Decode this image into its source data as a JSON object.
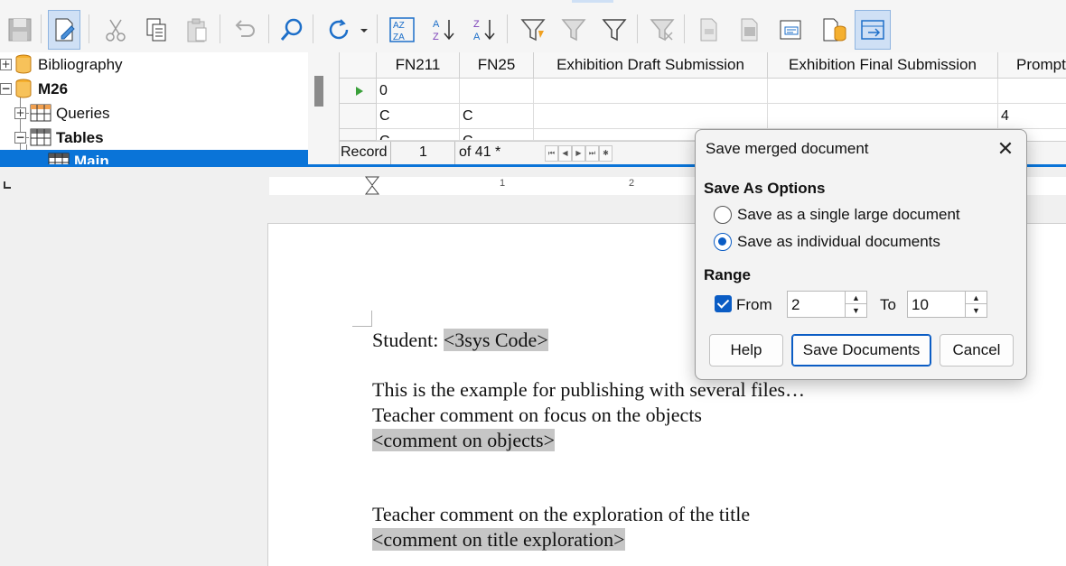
{
  "toolbar": {
    "icons": [
      "save-record-icon",
      "edit-data-icon",
      "cut-icon",
      "copy-icon",
      "paste-icon",
      "undo-icon",
      "find-record-icon",
      "refresh-icon",
      "sort-icon",
      "sort-ascending-icon",
      "sort-descending-icon",
      "autofilter-icon",
      "standard-filter-icon",
      "apply-filter-icon",
      "reset-filter-icon",
      "data-to-text-icon",
      "data-to-fields-icon",
      "mail-merge-icon",
      "data-source-icon",
      "explorer-toggle-icon"
    ]
  },
  "tree": {
    "items": [
      {
        "label": "Bibliography"
      },
      {
        "label": "M26"
      },
      {
        "label": "Queries"
      },
      {
        "label": "Tables"
      },
      {
        "label": "Main"
      }
    ]
  },
  "grid": {
    "columns": [
      "FN211",
      "FN25",
      "Exhibition Draft Submission",
      "Exhibition Final Submission",
      "Prompt"
    ],
    "rows": [
      [
        "0",
        "",
        "",
        "",
        ""
      ],
      [
        "C",
        "C",
        "",
        "",
        "4"
      ],
      [
        "C",
        "C",
        "",
        "",
        ""
      ]
    ],
    "nav": {
      "record_label": "Record",
      "record_value": "1",
      "of_label": "of 41 *"
    }
  },
  "ruler": {
    "numbers": [
      "1",
      "2"
    ]
  },
  "document": {
    "line1_label": "Student: ",
    "line1_field": "<3sys Code>",
    "line2": "This is the example for publishing with several files…",
    "line3": "Teacher comment on focus on the objects",
    "line4_field": "<comment on objects>",
    "line5": "Teacher comment on the exploration of the title",
    "line6_field": "<comment on title exploration>"
  },
  "dialog": {
    "title": "Save merged document",
    "save_as_heading": "Save As Options",
    "option_single": "Save as a single large document",
    "option_individual": "Save as individual documents",
    "selected_option": "individual",
    "range_heading": "Range",
    "from_label": "From",
    "from_value": "2",
    "from_checked": true,
    "to_label": "To",
    "to_value": "10",
    "help_label": "Help",
    "save_label": "Save Documents",
    "cancel_label": "Cancel"
  },
  "colors": {
    "selection": "#0a74d8",
    "accent": "#0a5cc4",
    "field_shading": "#c6c6c6"
  }
}
